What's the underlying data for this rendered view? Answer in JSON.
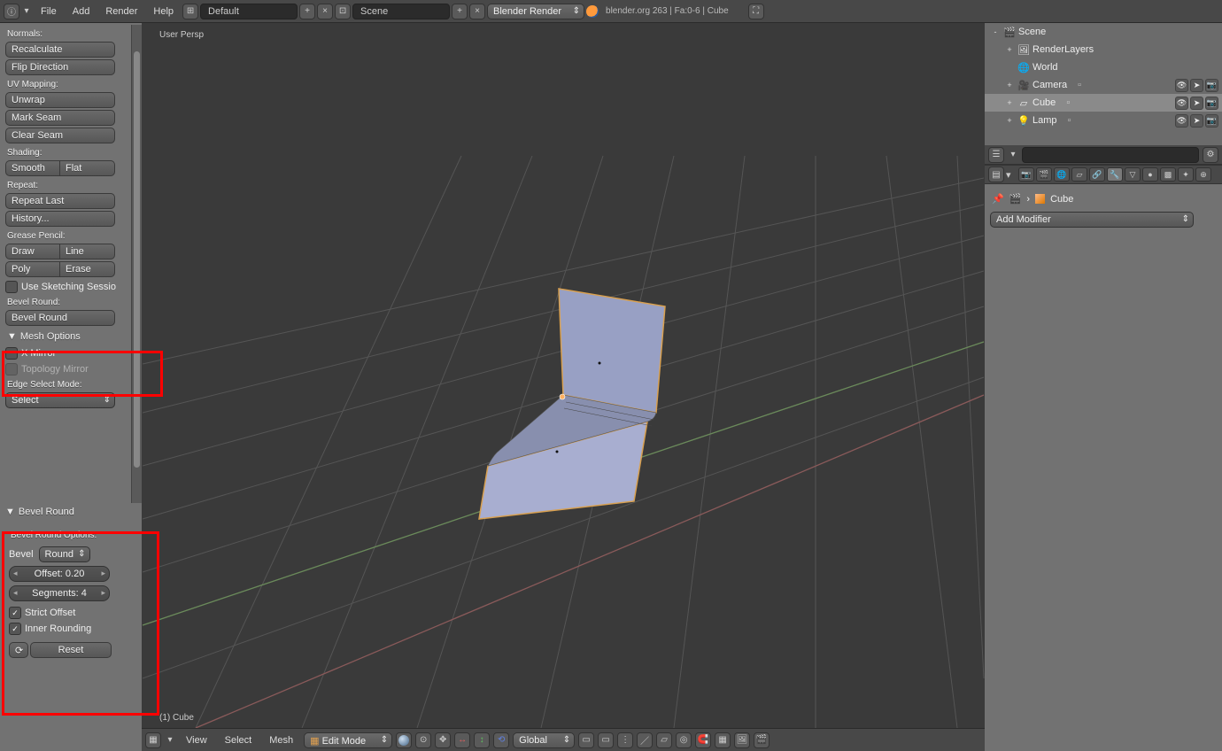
{
  "header": {
    "menus": [
      "File",
      "Add",
      "Render",
      "Help"
    ],
    "layout": "Default",
    "scene": "Scene",
    "engine": "Blender Render",
    "info": "blender.org 263 | Fa:0-6 | Cube"
  },
  "viewport": {
    "persp": "User Persp",
    "object": "(1) Cube",
    "footer": {
      "menus": [
        "View",
        "Select",
        "Mesh"
      ],
      "mode": "Edit Mode",
      "orientation": "Global"
    }
  },
  "tools": {
    "normals": {
      "label": "Normals:",
      "recalc": "Recalculate",
      "flip": "Flip Direction"
    },
    "uv": {
      "label": "UV Mapping:",
      "unwrap": "Unwrap",
      "mark": "Mark Seam",
      "clear": "Clear Seam"
    },
    "shading": {
      "label": "Shading:",
      "smooth": "Smooth",
      "flat": "Flat"
    },
    "repeat": {
      "label": "Repeat:",
      "last": "Repeat Last",
      "history": "History..."
    },
    "grease": {
      "label": "Grease Pencil:",
      "draw": "Draw",
      "line": "Line",
      "poly": "Poly",
      "erase": "Erase",
      "session": "Use Sketching Sessio"
    },
    "bevelround": {
      "label": "Bevel Round:",
      "btn": "Bevel Round"
    },
    "meshopts": {
      "header": "Mesh Options",
      "xmirror": "X Mirror",
      "topo": "Topology Mirror",
      "edgemode_label": "Edge Select Mode:",
      "edgemode_value": "Select"
    },
    "op": {
      "header": "Bevel Round",
      "options_label": "Bevel Round Options:",
      "bevel_label": "Bevel",
      "bevel_mode": "Round",
      "offset": "Offset: 0.20",
      "segments": "Segments: 4",
      "strict": "Strict Offset",
      "inner": "Inner Rounding",
      "reset": "Reset"
    }
  },
  "outliner": {
    "search_placeholder": "",
    "items": [
      {
        "name": "Scene",
        "icon": "scene",
        "depth": 0,
        "expand": "-"
      },
      {
        "name": "RenderLayers",
        "icon": "layers",
        "depth": 1,
        "expand": "+"
      },
      {
        "name": "World",
        "icon": "world",
        "depth": 1,
        "expand": ""
      },
      {
        "name": "Camera",
        "icon": "camera",
        "depth": 1,
        "expand": "+"
      },
      {
        "name": "Cube",
        "icon": "cube",
        "depth": 1,
        "expand": "+",
        "selected": true
      },
      {
        "name": "Lamp",
        "icon": "lamp",
        "depth": 1,
        "expand": "+"
      }
    ]
  },
  "properties": {
    "breadcrumb": "Cube",
    "add_modifier": "Add Modifier"
  }
}
